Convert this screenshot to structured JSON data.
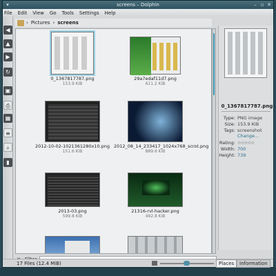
{
  "window": {
    "title": "screens – Dolphin"
  },
  "menu": [
    "File",
    "Edit",
    "View",
    "Go",
    "Tools",
    "Settings",
    "Help"
  ],
  "breadcrumb": [
    "Pictures",
    "screens"
  ],
  "files": [
    {
      "name": "0_1367817787.png",
      "size": "153.9 KiB",
      "selected": true
    },
    {
      "name": "29a7edaf11d7.png",
      "size": "611.2 KiB"
    },
    {
      "name": "2012-10-02-1021361280x10.png",
      "size": "151.6 KiB"
    },
    {
      "name": "2012_08_14_233417_1024x768_scrot.png",
      "size": "889.6 KiB"
    },
    {
      "name": "2013-03.png",
      "size": "599.8 KiB"
    },
    {
      "name": "21316-rvl-hacker.png",
      "size": "492.8 KiB"
    }
  ],
  "filter": {
    "close": "✕",
    "label": "Filter"
  },
  "status": {
    "text": "17 Files (12.4 MiB)"
  },
  "panel_tabs": {
    "places": "Places",
    "information": "Information"
  },
  "info": {
    "filename": "0_1367817787.png",
    "type_label": "Type:",
    "type": "PNG image",
    "size_label": "Size:",
    "size": "153.9 KiB",
    "tags_label": "Tags:",
    "tags": "screenshot",
    "change": "Change...",
    "rating_label": "Rating:",
    "rating": 0,
    "width_label": "Width:",
    "width": "700",
    "height_label": "Height:",
    "height": "739"
  },
  "colors": {
    "accent": "#3e97b4",
    "titlebar": "#2f5260"
  }
}
